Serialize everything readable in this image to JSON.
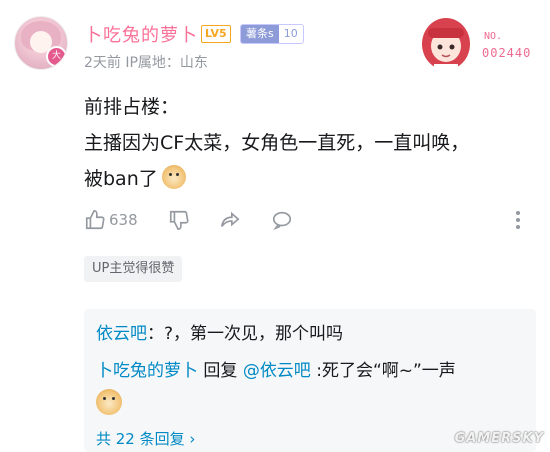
{
  "comment": {
    "username": "卜吃兔的萝卜",
    "level": "LV5",
    "fan_badge": {
      "name": "薯条s",
      "level": "10"
    },
    "meta": "2天前  IP属地：山东",
    "avatar_badge": "大",
    "card": {
      "no_label": "NO.",
      "number": "002440"
    },
    "lines": [
      "前排占楼：",
      "主播因为CF太菜，女角色一直死，一直叫唤，",
      "被ban了"
    ],
    "likes": "638",
    "up_tag": "UP主觉得很赞"
  },
  "replies": [
    {
      "author": "依云吧",
      "text": "：?，第一次见，那个叫吗"
    },
    {
      "author": "卜吃兔的萝卜",
      "middle": " 回复 ",
      "mention": "@依云吧",
      "text": " :死了会“啊~”一声"
    }
  ],
  "more_replies": "共 22 条回复 ›",
  "watermark": "GAMERSKY",
  "colors": {
    "pink": "#fb7299",
    "link_blue": "#008ac5",
    "gray": "#9499a0"
  }
}
